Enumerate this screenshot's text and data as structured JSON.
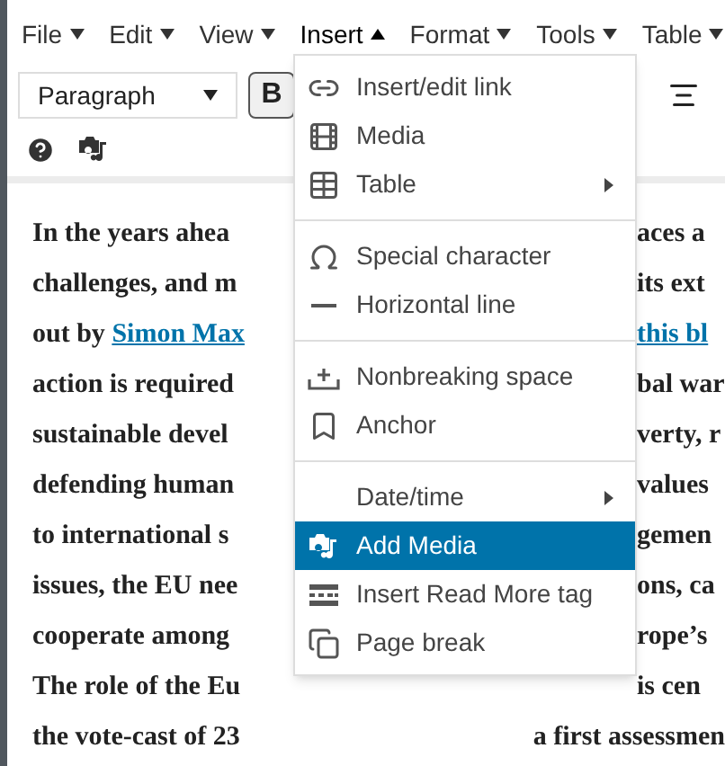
{
  "menubar": [
    {
      "label": "File",
      "selected": false
    },
    {
      "label": "Edit",
      "selected": false
    },
    {
      "label": "View",
      "selected": false
    },
    {
      "label": "Insert",
      "selected": true
    },
    {
      "label": "Format",
      "selected": false
    },
    {
      "label": "Tools",
      "selected": false
    },
    {
      "label": "Table",
      "selected": false
    }
  ],
  "toolbar": {
    "format_select": "Paragraph",
    "bold": "B"
  },
  "content": {
    "lines": [
      {
        "left": "In the years ahea",
        "right": "aces a"
      },
      {
        "left": "challenges, and m",
        "right": "its ext"
      },
      {
        "left": "out by ",
        "left_link": "Simon Max",
        "right_link": "this bl"
      },
      {
        "left": "action is required",
        "right": "bal war"
      },
      {
        "left": "sustainable devel",
        "right": "verty, r"
      },
      {
        "left": "defending human",
        "right": "values"
      },
      {
        "left": "to international s",
        "right": "gemen"
      },
      {
        "left": "issues, the EU nee",
        "right": "ons, ca"
      },
      {
        "left": "cooperate among",
        "right": "rope’s"
      },
      {
        "left": "The role of the Eu",
        "right": "is cen"
      },
      {
        "left": "the vote-cast of 23",
        "right": "a first assessmen"
      }
    ]
  },
  "insert_menu": {
    "groups": [
      [
        {
          "label": "Insert/edit link",
          "submenu": false,
          "selected": false
        },
        {
          "label": "Media",
          "submenu": false,
          "selected": false
        },
        {
          "label": "Table",
          "submenu": true,
          "selected": false
        }
      ],
      [
        {
          "label": "Special character",
          "submenu": false,
          "selected": false
        },
        {
          "label": "Horizontal line",
          "submenu": false,
          "selected": false
        }
      ],
      [
        {
          "label": "Nonbreaking space",
          "submenu": false,
          "selected": false
        },
        {
          "label": "Anchor",
          "submenu": false,
          "selected": false
        }
      ],
      [
        {
          "label": "Date/time",
          "submenu": true,
          "selected": false
        },
        {
          "label": "Add Media",
          "submenu": false,
          "selected": true
        },
        {
          "label": "Insert Read More tag",
          "submenu": false,
          "selected": false
        },
        {
          "label": "Page break",
          "submenu": false,
          "selected": false
        }
      ]
    ]
  }
}
